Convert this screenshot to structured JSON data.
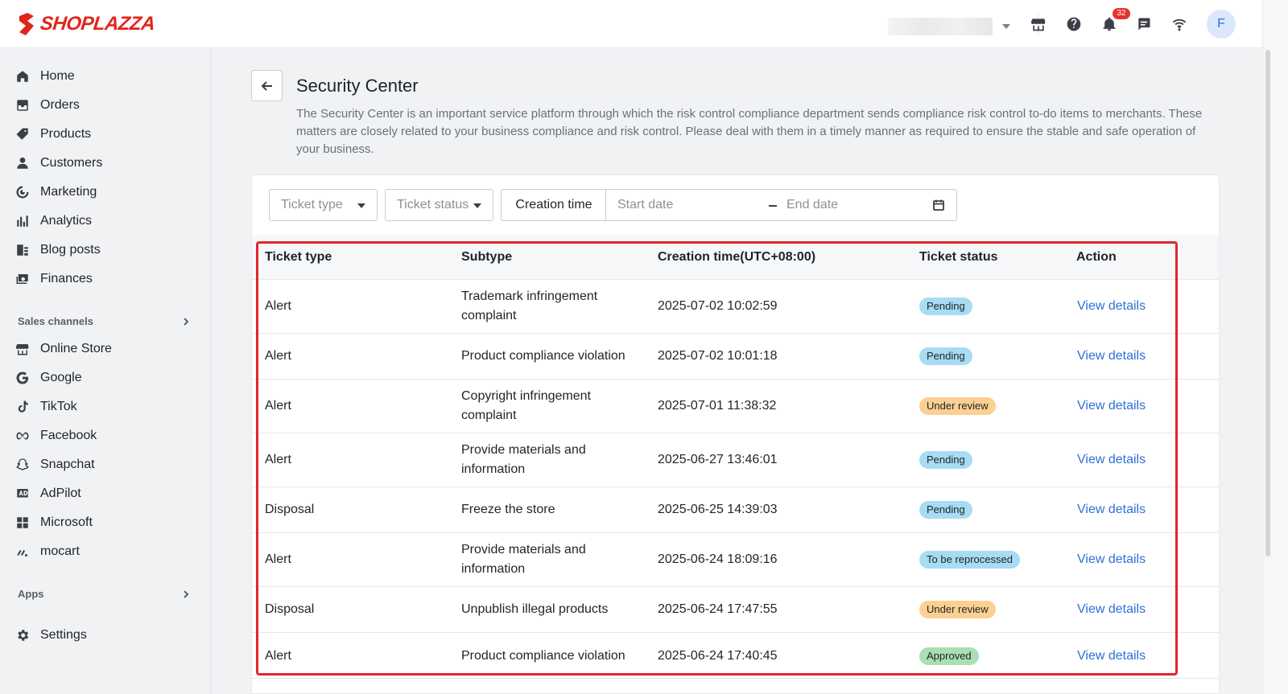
{
  "brand": {
    "name": "SHOPLAZZA",
    "color": "#e1251b"
  },
  "topbar": {
    "icons": [
      "store-icon",
      "help-icon",
      "bell-icon",
      "chat-icon",
      "wifi-icon"
    ],
    "notification_count": "32",
    "avatar_initial": "F"
  },
  "sidebar": {
    "items": [
      {
        "label": "Home",
        "icon": "home-icon"
      },
      {
        "label": "Orders",
        "icon": "orders-icon"
      },
      {
        "label": "Products",
        "icon": "tag-icon"
      },
      {
        "label": "Customers",
        "icon": "person-icon"
      },
      {
        "label": "Marketing",
        "icon": "marketing-icon"
      },
      {
        "label": "Analytics",
        "icon": "bar-chart-icon"
      },
      {
        "label": "Blog posts",
        "icon": "blog-icon"
      },
      {
        "label": "Finances",
        "icon": "finance-icon"
      }
    ],
    "sales_channels_label": "Sales channels",
    "channels": [
      {
        "label": "Online Store",
        "icon": "storefront-icon"
      },
      {
        "label": "Google",
        "icon": "google-icon"
      },
      {
        "label": "TikTok",
        "icon": "tiktok-icon"
      },
      {
        "label": "Facebook",
        "icon": "meta-icon"
      },
      {
        "label": "Snapchat",
        "icon": "snapchat-icon"
      },
      {
        "label": "AdPilot",
        "icon": "ad-icon"
      },
      {
        "label": "Microsoft",
        "icon": "microsoft-icon"
      },
      {
        "label": "mocart",
        "icon": "mocart-icon"
      }
    ],
    "apps_label": "Apps",
    "settings_label": "Settings"
  },
  "page": {
    "title": "Security Center",
    "description": "The Security Center is an important service platform through which the risk control compliance department sends compliance risk control to-do items to merchants. These matters are closely related to your business compliance and risk control. Please deal with them in a timely manner as required to ensure the stable and safe operation of your business."
  },
  "filters": {
    "ticket_type_placeholder": "Ticket type",
    "ticket_status_placeholder": "Ticket status",
    "creation_time_label": "Creation time",
    "start_date_placeholder": "Start date",
    "end_date_placeholder": "End date"
  },
  "table": {
    "headers": [
      "Ticket type",
      "Subtype",
      "Creation time(UTC+08:00)",
      "Ticket status",
      "Action"
    ],
    "rows": [
      {
        "type": "Alert",
        "subtype": "Trademark infringement complaint",
        "time": "2025-07-02 10:02:59",
        "status": "Pending",
        "status_kind": "pending",
        "action": "View details"
      },
      {
        "type": "Alert",
        "subtype": "Product compliance violation",
        "time": "2025-07-02 10:01:18",
        "status": "Pending",
        "status_kind": "pending",
        "action": "View details"
      },
      {
        "type": "Alert",
        "subtype": "Copyright infringement complaint",
        "time": "2025-07-01 11:38:32",
        "status": "Under review",
        "status_kind": "review",
        "action": "View details"
      },
      {
        "type": "Alert",
        "subtype": "Provide materials and information",
        "time": "2025-06-27 13:46:01",
        "status": "Pending",
        "status_kind": "pending",
        "action": "View details"
      },
      {
        "type": "Disposal",
        "subtype": "Freeze the store",
        "time": "2025-06-25 14:39:03",
        "status": "Pending",
        "status_kind": "pending",
        "action": "View details"
      },
      {
        "type": "Alert",
        "subtype": "Provide materials and information",
        "time": "2025-06-24 18:09:16",
        "status": "To be reprocessed",
        "status_kind": "reprocess",
        "action": "View details"
      },
      {
        "type": "Disposal",
        "subtype": "Unpublish illegal products",
        "time": "2025-06-24 17:47:55",
        "status": "Under review",
        "status_kind": "review",
        "action": "View details"
      },
      {
        "type": "Alert",
        "subtype": "Product compliance violation",
        "time": "2025-06-24 17:40:45",
        "status": "Approved",
        "status_kind": "approved",
        "action": "View details"
      }
    ]
  },
  "colors": {
    "link": "#2f6fd6",
    "pending": "#a7dcf2",
    "under_review": "#fccf92",
    "approved": "#a9dfb1",
    "highlight": "#e0262f"
  }
}
